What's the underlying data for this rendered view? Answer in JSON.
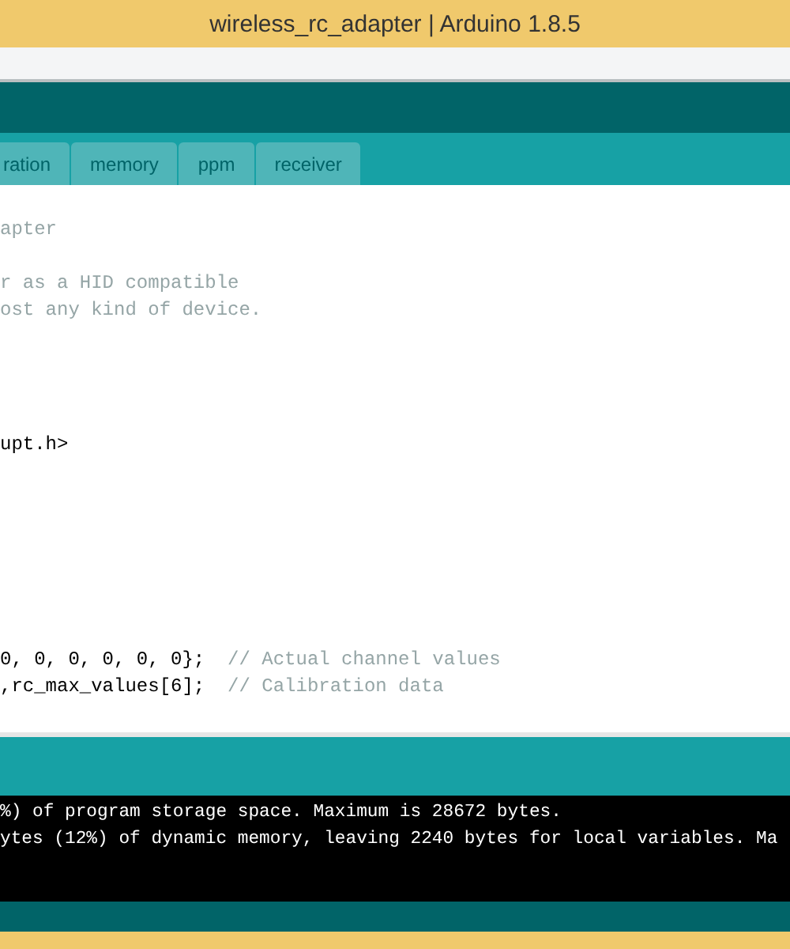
{
  "window": {
    "title": "wireless_rc_adapter | Arduino 1.8.5"
  },
  "tabs": [
    {
      "label": "ration",
      "selected": false
    },
    {
      "label": "memory",
      "selected": false
    },
    {
      "label": "ppm",
      "selected": false
    },
    {
      "label": "receiver",
      "selected": false
    }
  ],
  "editor": {
    "lines": [
      {
        "comment": "apter"
      },
      {
        "comment": "r as a HID compatible"
      },
      {
        "comment": "ost any kind of device."
      },
      {
        "code": "upt.h>"
      },
      {
        "code": "0, 0, 0, 0, 0, 0};  ",
        "comment": "// Actual channel values"
      },
      {
        "code": ",rc_max_values[6];  ",
        "comment": "// Calibration data"
      }
    ]
  },
  "console": {
    "lines": [
      "%) of program storage space. Maximum is 28672 bytes.",
      "ytes (12%) of dynamic memory, leaving 2240 bytes for local variables. Ma"
    ]
  }
}
